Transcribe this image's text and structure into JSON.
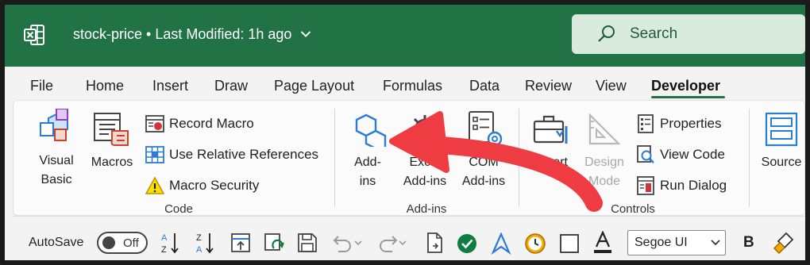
{
  "titlebar": {
    "doc_title": "stock-price • Last Modified: 1h ago",
    "search_label": "Search"
  },
  "menu": [
    "File",
    "Home",
    "Insert",
    "Draw",
    "Page Layout",
    "Formulas",
    "Data",
    "Review",
    "View",
    "Developer"
  ],
  "menu_active": "Developer",
  "ribbon": {
    "code": {
      "visual_basic": [
        "Visual",
        "Basic"
      ],
      "macros": "Macros",
      "record_macro": "Record Macro",
      "use_relative": "Use Relative References",
      "macro_security": "Macro Security",
      "group": "Code"
    },
    "addins": {
      "addins": [
        "Add-",
        "ins"
      ],
      "excel_addins": [
        "Excel",
        "Add-ins"
      ],
      "com_addins": [
        "COM",
        "Add-ins"
      ],
      "group": "Add-ins"
    },
    "controls": {
      "insert": "Insert",
      "design_mode": [
        "Design",
        "Mode"
      ],
      "properties": "Properties",
      "view_code": "View Code",
      "run_dialog": "Run Dialog",
      "group": "Controls"
    },
    "source": "Source"
  },
  "qat": {
    "autosave": "AutoSave",
    "toggle": "Off",
    "font": "Segoe UI",
    "bold": "B"
  },
  "colors": {
    "brand": "#217346",
    "arrow": "#ef3b42",
    "addins_icon": "#2b7cd3"
  }
}
